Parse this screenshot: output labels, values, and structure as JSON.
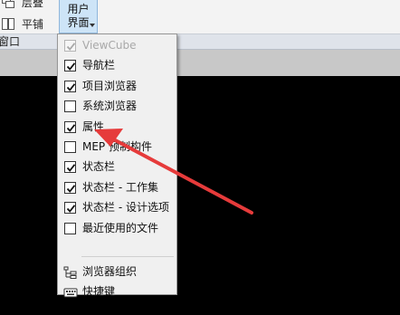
{
  "ribbon": {
    "stack_label": "层叠",
    "tile_label": "平铺",
    "user_interface_line1": "用户",
    "user_interface_line2": "界面"
  },
  "panel": {
    "window_label": "窗口"
  },
  "menu": {
    "items": [
      {
        "label": "ViewCube",
        "checked": true,
        "enabled": false
      },
      {
        "label": "导航栏",
        "checked": true,
        "enabled": true
      },
      {
        "label": "项目浏览器",
        "checked": true,
        "enabled": true
      },
      {
        "label": "系统浏览器",
        "checked": false,
        "enabled": true
      },
      {
        "label": "属性",
        "checked": true,
        "enabled": true
      },
      {
        "label": "MEP 预制构件",
        "checked": false,
        "enabled": true
      },
      {
        "label": "状态栏",
        "checked": true,
        "enabled": true
      },
      {
        "label": "状态栏 - 工作集",
        "checked": true,
        "enabled": true
      },
      {
        "label": "状态栏 - 设计选项",
        "checked": true,
        "enabled": true
      },
      {
        "label": "最近使用的文件",
        "checked": false,
        "enabled": true
      }
    ],
    "browser_org_label": "浏览器组织",
    "shortcuts_label": "快捷键"
  },
  "annotation": {
    "arrow_color": "#e63b3b"
  }
}
